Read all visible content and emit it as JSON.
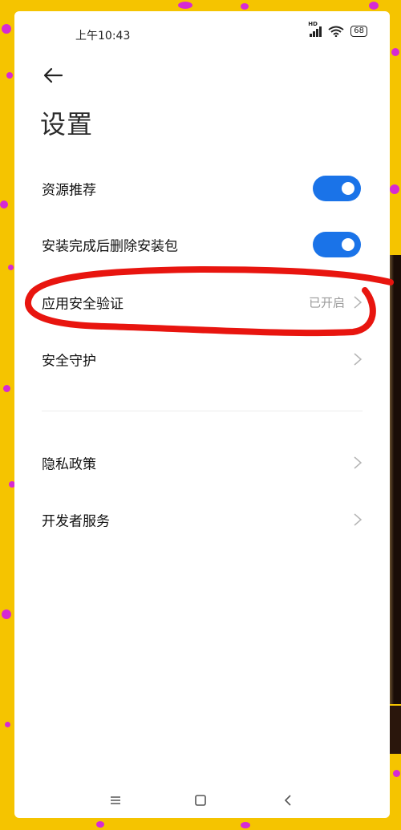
{
  "status_bar": {
    "time": "上午10:43",
    "network": "HD",
    "battery": "68"
  },
  "header": {
    "back_icon": "arrow-left-icon",
    "title": "设置"
  },
  "settings": {
    "resource_recommend": {
      "label": "资源推荐",
      "enabled": true
    },
    "delete_package": {
      "label": "安装完成后删除安装包",
      "enabled": true
    },
    "app_security": {
      "label": "应用安全验证",
      "status": "已开启"
    },
    "security_protect": {
      "label": "安全守护"
    },
    "privacy_policy": {
      "label": "隐私政策"
    },
    "developer_service": {
      "label": "开发者服务"
    }
  },
  "nav_bar": {
    "icons": [
      "menu-icon",
      "home-icon",
      "back-icon"
    ]
  },
  "colors": {
    "toggle_on": "#1a73e8",
    "annotation_red": "#e8150f",
    "frame_yellow": "#f5c400"
  }
}
